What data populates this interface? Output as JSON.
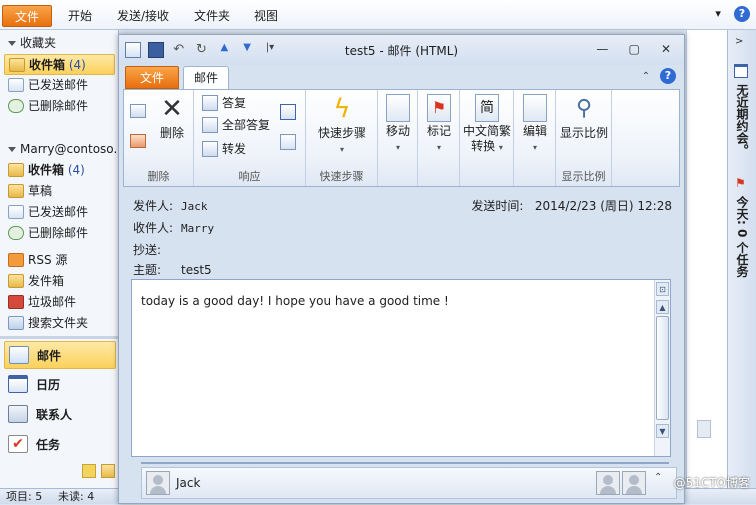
{
  "main_tabs": [
    {
      "label": "文件"
    },
    {
      "label": "开始"
    },
    {
      "label": "发送/接收"
    },
    {
      "label": "文件夹"
    },
    {
      "label": "视图"
    }
  ],
  "nav": {
    "favorites_header": "收藏夹",
    "favorites": [
      {
        "label": "收件箱",
        "count": "(4)",
        "selected": true
      },
      {
        "label": "已发送邮件"
      },
      {
        "label": "已删除邮件"
      }
    ],
    "account_header": "Marry@contoso.c",
    "account_folders": [
      {
        "label": "收件箱",
        "count": "(4)"
      },
      {
        "label": "草稿"
      },
      {
        "label": "已发送邮件"
      },
      {
        "label": "已删除邮件"
      },
      {
        "label": "RSS 源"
      },
      {
        "label": "发件箱"
      },
      {
        "label": "垃圾邮件"
      },
      {
        "label": "搜索文件夹"
      }
    ],
    "modules": [
      {
        "label": "邮件"
      },
      {
        "label": "日历"
      },
      {
        "label": "联系人"
      },
      {
        "label": "任务"
      }
    ]
  },
  "status": {
    "items_label": "项目: 5",
    "unread_label": "未读: 4"
  },
  "todo_bar": {
    "appointments": "无近期约会。",
    "tasks": "今天: 0 个任务"
  },
  "window": {
    "title": "test5  -  邮件 (HTML)",
    "tabs": {
      "file": "文件",
      "mail": "邮件"
    }
  },
  "ribbon": {
    "groups": {
      "delete": "删除",
      "respond": "响应",
      "quicksteps": "快速步骤",
      "zoom": "显示比例"
    },
    "buttons": {
      "delete": "删除",
      "reply": "答复",
      "reply_all": "全部答复",
      "forward": "转发",
      "quicksteps": "快速步骤",
      "move": "移动",
      "tag": "标记",
      "convert_line1": "中文简繁",
      "convert_line2": "转换",
      "edit": "编辑",
      "zoom": "显示比例"
    }
  },
  "message": {
    "from_label": "发件人:",
    "from": "Jack",
    "to_label": "收件人:",
    "to": "Marry",
    "cc_label": "抄送:",
    "subject_label": "主题:",
    "subject": "test5",
    "sent_label": "发送时间:",
    "sent_time": "2014/2/23 (周日) 12:28",
    "body": "today is a good day! I hope you have a good time !"
  },
  "people_pane": {
    "name": "Jack"
  },
  "watermark": "@51CTO博客",
  "colors": {
    "file_tab": "#e96f0d",
    "selection": "#fbd15c",
    "window_frame": "#8ea6c8"
  }
}
